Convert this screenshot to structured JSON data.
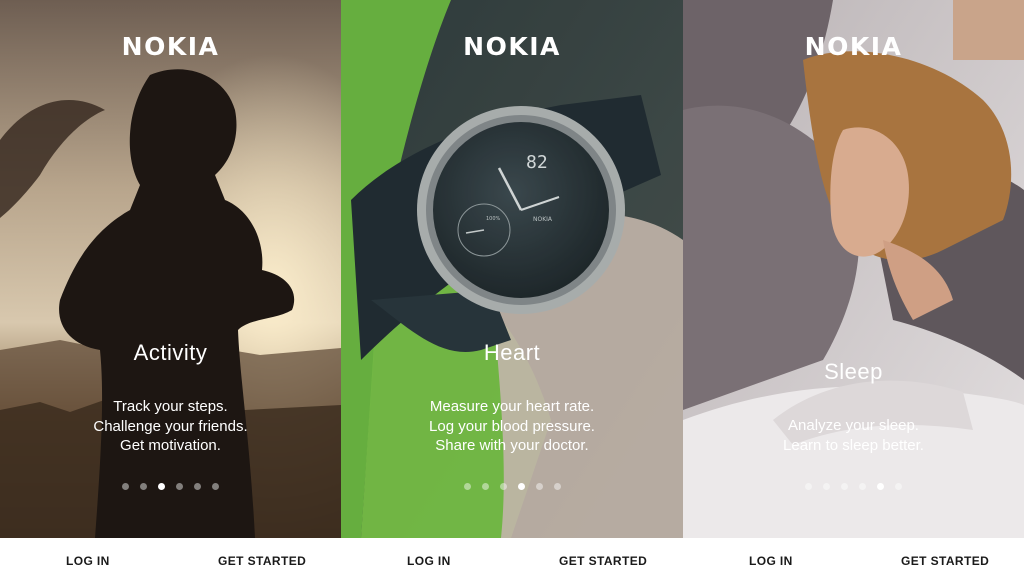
{
  "panels": [
    {
      "brand": "NOKIA",
      "title": "Activity",
      "lines": [
        "Track your steps.",
        "Challenge your friends.",
        "Get motivation."
      ],
      "pager": {
        "count": 6,
        "active_index": 2
      },
      "actions": {
        "login": "LOG IN",
        "get_started": "GET STARTED"
      }
    },
    {
      "brand": "NOKIA",
      "title": "Heart",
      "watch": {
        "display_value": "82",
        "subdial_label": "100%",
        "face_brand": "NOKIA"
      },
      "lines": [
        "Measure your heart rate.",
        "Log your blood pressure.",
        "Share with your doctor."
      ],
      "pager": {
        "count": 6,
        "active_index": 3
      },
      "actions": {
        "login": "LOG IN",
        "get_started": "GET STARTED"
      }
    },
    {
      "brand": "NOKIA",
      "title": "Sleep",
      "lines": [
        "Analyze your sleep.",
        "Learn to sleep better."
      ],
      "pager": {
        "count": 6,
        "active_index": 4
      },
      "actions": {
        "login": "LOG IN",
        "get_started": "GET STARTED"
      }
    }
  ],
  "colors": {
    "activity_sky": "#cfc2ad",
    "heart_green": "#86d24a",
    "sleep_sheet": "#e6e2e2",
    "text_on_image": "#ffffff",
    "bar_text": "#1a1a1a"
  }
}
